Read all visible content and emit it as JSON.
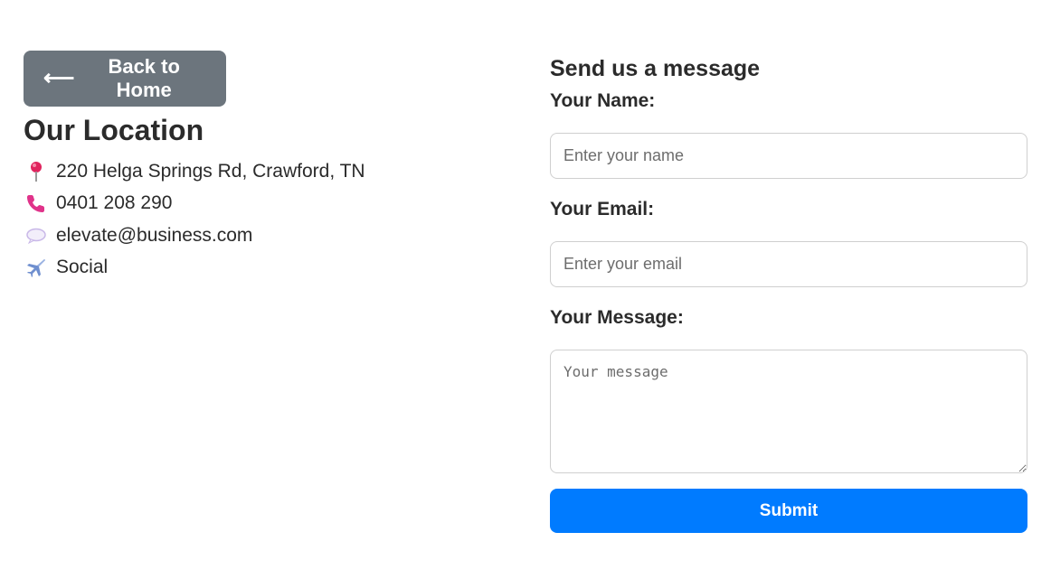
{
  "back_button": {
    "arrow": "⟵",
    "label": "Back to Home"
  },
  "location": {
    "title": "Our Location",
    "items": [
      {
        "icon": "pin-icon",
        "text": "220 Helga Springs Rd, Crawford, TN"
      },
      {
        "icon": "phone-icon",
        "text": "0401 208 290"
      },
      {
        "icon": "speech-bubble-icon",
        "text": "elevate@business.com"
      },
      {
        "icon": "airplane-icon",
        "text": "Social"
      }
    ]
  },
  "form": {
    "title": "Send us a message",
    "name_label": "Your Name:",
    "name_placeholder": "Enter your name",
    "name_value": "",
    "email_label": "Your Email:",
    "email_placeholder": "Enter your email",
    "email_value": "",
    "message_label": "Your Message:",
    "message_placeholder": "Your message",
    "message_value": "",
    "submit_label": "Submit"
  },
  "colors": {
    "back_button_bg": "#6c757d",
    "submit_button_bg": "#007bff",
    "text": "#2b2b2b",
    "input_border": "#cfcfcf"
  }
}
